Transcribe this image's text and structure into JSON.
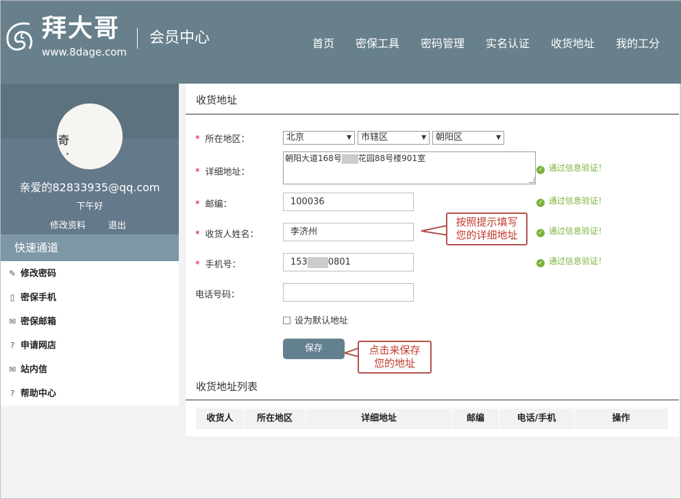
{
  "header": {
    "logo_name": "拜大哥",
    "logo_url": "www.8dage.com",
    "member_center": "会员中心",
    "nav": [
      "首页",
      "密保工具",
      "密码管理",
      "实名认证",
      "收货地址",
      "我的工分"
    ]
  },
  "profile": {
    "email": "亲爱的82833935@qq.com",
    "greeting": "下午好",
    "edit": "修改资料",
    "logout": "退出"
  },
  "quick": {
    "title": "快速通道",
    "items": [
      {
        "icon": "edit-icon",
        "label": "修改密码"
      },
      {
        "icon": "phone-icon",
        "label": "密保手机"
      },
      {
        "icon": "mail-icon",
        "label": "密保邮箱"
      },
      {
        "icon": "help-icon",
        "label": "申请网店"
      },
      {
        "icon": "mail-icon",
        "label": "站内信"
      },
      {
        "icon": "help-icon",
        "label": "帮助中心"
      }
    ]
  },
  "form": {
    "title": "收货地址",
    "region_label": "所在地区：",
    "region": [
      "北京",
      "市辖区",
      "朝阳区"
    ],
    "address_label": "详细地址：",
    "address_value_a": "朝阳大道168号",
    "address_value_b": "花园88号楼901室",
    "zip_label": "邮编：",
    "zip_value": "100036",
    "name_label": "收货人姓名：",
    "name_value": "李济州",
    "mobile_label": "手机号：",
    "mobile_value_a": "153",
    "mobile_value_b": "0801",
    "phone_label": "电话号码：",
    "default_label": "设为默认地址",
    "save": "保存",
    "ok_text": "通过信息验证！"
  },
  "list": {
    "title": "收货地址列表",
    "columns": [
      "收货人",
      "所在地区",
      "详细地址",
      "邮编",
      "电话/手机",
      "操作"
    ]
  },
  "callouts": {
    "fill_hint": [
      "按照提示填写",
      "您的详细地址"
    ],
    "save_hint": [
      "点击来保存",
      "您的地址"
    ]
  }
}
